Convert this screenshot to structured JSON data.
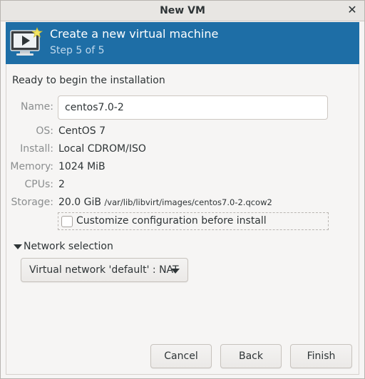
{
  "window": {
    "title": "New VM",
    "close_icon": "close-icon"
  },
  "banner": {
    "heading": "Create a new virtual machine",
    "step": "Step 5 of 5",
    "icon": "vm-monitor-icon",
    "color": "#1e6ea6"
  },
  "summary": {
    "ready_text": "Ready to begin the installation",
    "name_label": "Name:",
    "name_value": "centos7.0-2",
    "os_label": "OS:",
    "os_value": "CentOS 7",
    "install_label": "Install:",
    "install_value": "Local CDROM/ISO",
    "memory_label": "Memory:",
    "memory_value": "1024 MiB",
    "cpus_label": "CPUs:",
    "cpus_value": "2",
    "storage_label": "Storage:",
    "storage_size": "20.0 GiB",
    "storage_path": "/var/lib/libvirt/images/centos7.0-2.qcow2",
    "customize_label": "Customize configuration before install",
    "customize_checked": false
  },
  "network": {
    "expander_label": "Network selection",
    "selected": "Virtual network 'default' : NAT"
  },
  "buttons": {
    "cancel": "Cancel",
    "back": "Back",
    "finish": "Finish"
  }
}
